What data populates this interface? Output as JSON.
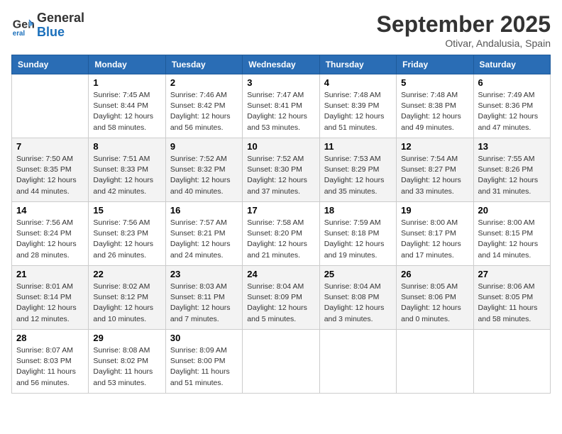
{
  "header": {
    "logo_line1": "General",
    "logo_line2": "Blue",
    "month": "September 2025",
    "location": "Otivar, Andalusia, Spain"
  },
  "columns": [
    "Sunday",
    "Monday",
    "Tuesday",
    "Wednesday",
    "Thursday",
    "Friday",
    "Saturday"
  ],
  "weeks": [
    [
      {
        "day": "",
        "empty": true
      },
      {
        "day": "1",
        "sunrise": "7:45 AM",
        "sunset": "8:44 PM",
        "daylight": "12 hours and 58 minutes."
      },
      {
        "day": "2",
        "sunrise": "7:46 AM",
        "sunset": "8:42 PM",
        "daylight": "12 hours and 56 minutes."
      },
      {
        "day": "3",
        "sunrise": "7:47 AM",
        "sunset": "8:41 PM",
        "daylight": "12 hours and 53 minutes."
      },
      {
        "day": "4",
        "sunrise": "7:48 AM",
        "sunset": "8:39 PM",
        "daylight": "12 hours and 51 minutes."
      },
      {
        "day": "5",
        "sunrise": "7:48 AM",
        "sunset": "8:38 PM",
        "daylight": "12 hours and 49 minutes."
      },
      {
        "day": "6",
        "sunrise": "7:49 AM",
        "sunset": "8:36 PM",
        "daylight": "12 hours and 47 minutes."
      }
    ],
    [
      {
        "day": "7",
        "sunrise": "7:50 AM",
        "sunset": "8:35 PM",
        "daylight": "12 hours and 44 minutes."
      },
      {
        "day": "8",
        "sunrise": "7:51 AM",
        "sunset": "8:33 PM",
        "daylight": "12 hours and 42 minutes."
      },
      {
        "day": "9",
        "sunrise": "7:52 AM",
        "sunset": "8:32 PM",
        "daylight": "12 hours and 40 minutes."
      },
      {
        "day": "10",
        "sunrise": "7:52 AM",
        "sunset": "8:30 PM",
        "daylight": "12 hours and 37 minutes."
      },
      {
        "day": "11",
        "sunrise": "7:53 AM",
        "sunset": "8:29 PM",
        "daylight": "12 hours and 35 minutes."
      },
      {
        "day": "12",
        "sunrise": "7:54 AM",
        "sunset": "8:27 PM",
        "daylight": "12 hours and 33 minutes."
      },
      {
        "day": "13",
        "sunrise": "7:55 AM",
        "sunset": "8:26 PM",
        "daylight": "12 hours and 31 minutes."
      }
    ],
    [
      {
        "day": "14",
        "sunrise": "7:56 AM",
        "sunset": "8:24 PM",
        "daylight": "12 hours and 28 minutes."
      },
      {
        "day": "15",
        "sunrise": "7:56 AM",
        "sunset": "8:23 PM",
        "daylight": "12 hours and 26 minutes."
      },
      {
        "day": "16",
        "sunrise": "7:57 AM",
        "sunset": "8:21 PM",
        "daylight": "12 hours and 24 minutes."
      },
      {
        "day": "17",
        "sunrise": "7:58 AM",
        "sunset": "8:20 PM",
        "daylight": "12 hours and 21 minutes."
      },
      {
        "day": "18",
        "sunrise": "7:59 AM",
        "sunset": "8:18 PM",
        "daylight": "12 hours and 19 minutes."
      },
      {
        "day": "19",
        "sunrise": "8:00 AM",
        "sunset": "8:17 PM",
        "daylight": "12 hours and 17 minutes."
      },
      {
        "day": "20",
        "sunrise": "8:00 AM",
        "sunset": "8:15 PM",
        "daylight": "12 hours and 14 minutes."
      }
    ],
    [
      {
        "day": "21",
        "sunrise": "8:01 AM",
        "sunset": "8:14 PM",
        "daylight": "12 hours and 12 minutes."
      },
      {
        "day": "22",
        "sunrise": "8:02 AM",
        "sunset": "8:12 PM",
        "daylight": "12 hours and 10 minutes."
      },
      {
        "day": "23",
        "sunrise": "8:03 AM",
        "sunset": "8:11 PM",
        "daylight": "12 hours and 7 minutes."
      },
      {
        "day": "24",
        "sunrise": "8:04 AM",
        "sunset": "8:09 PM",
        "daylight": "12 hours and 5 minutes."
      },
      {
        "day": "25",
        "sunrise": "8:04 AM",
        "sunset": "8:08 PM",
        "daylight": "12 hours and 3 minutes."
      },
      {
        "day": "26",
        "sunrise": "8:05 AM",
        "sunset": "8:06 PM",
        "daylight": "12 hours and 0 minutes."
      },
      {
        "day": "27",
        "sunrise": "8:06 AM",
        "sunset": "8:05 PM",
        "daylight": "11 hours and 58 minutes."
      }
    ],
    [
      {
        "day": "28",
        "sunrise": "8:07 AM",
        "sunset": "8:03 PM",
        "daylight": "11 hours and 56 minutes."
      },
      {
        "day": "29",
        "sunrise": "8:08 AM",
        "sunset": "8:02 PM",
        "daylight": "11 hours and 53 minutes."
      },
      {
        "day": "30",
        "sunrise": "8:09 AM",
        "sunset": "8:00 PM",
        "daylight": "11 hours and 51 minutes."
      },
      {
        "day": "",
        "empty": true
      },
      {
        "day": "",
        "empty": true
      },
      {
        "day": "",
        "empty": true
      },
      {
        "day": "",
        "empty": true
      }
    ]
  ]
}
